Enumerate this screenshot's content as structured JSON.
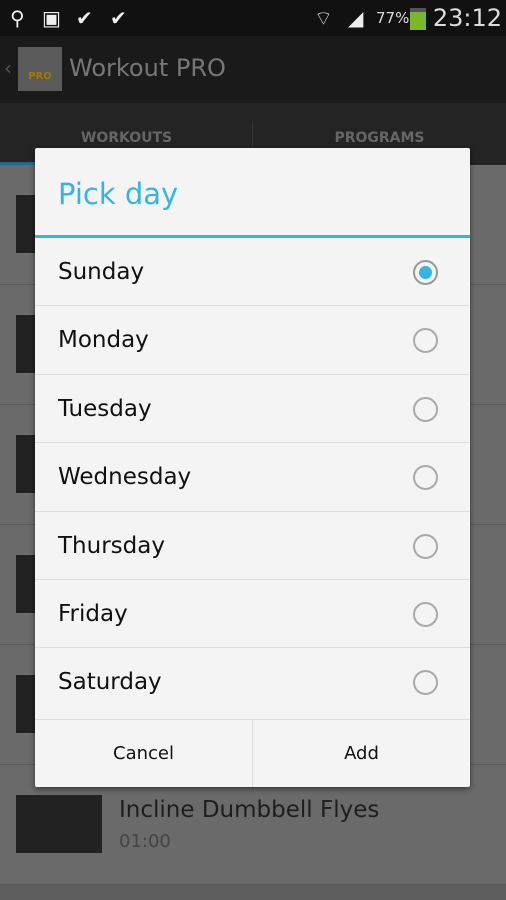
{
  "status_bar": {
    "battery": "77%",
    "time": "23:12",
    "icons": [
      "usb-icon",
      "gallery-icon",
      "check-icon",
      "check-icon",
      "wifi-icon",
      "signal-icon",
      "battery-charging-icon"
    ]
  },
  "app": {
    "title": "Workout PRO",
    "logo_text": "PRO"
  },
  "tabs": [
    {
      "label": "WORKOUTS",
      "active": true
    },
    {
      "label": "PROGRAMS",
      "active": false
    }
  ],
  "list": {
    "items": [
      {
        "title": "",
        "subtitle": ""
      },
      {
        "title": "",
        "subtitle": ""
      },
      {
        "title": "",
        "subtitle": ""
      },
      {
        "title": "",
        "subtitle": ""
      },
      {
        "title": "",
        "subtitle": ""
      },
      {
        "title": "Incline Dumbbell Flyes",
        "subtitle": "01:00"
      }
    ]
  },
  "dialog": {
    "title": "Pick day",
    "options": [
      "Sunday",
      "Monday",
      "Tuesday",
      "Wednesday",
      "Thursday",
      "Friday",
      "Saturday"
    ],
    "selected": "Sunday",
    "cancel": "Cancel",
    "add": "Add"
  },
  "colors": {
    "accent": "#33b5e5"
  }
}
